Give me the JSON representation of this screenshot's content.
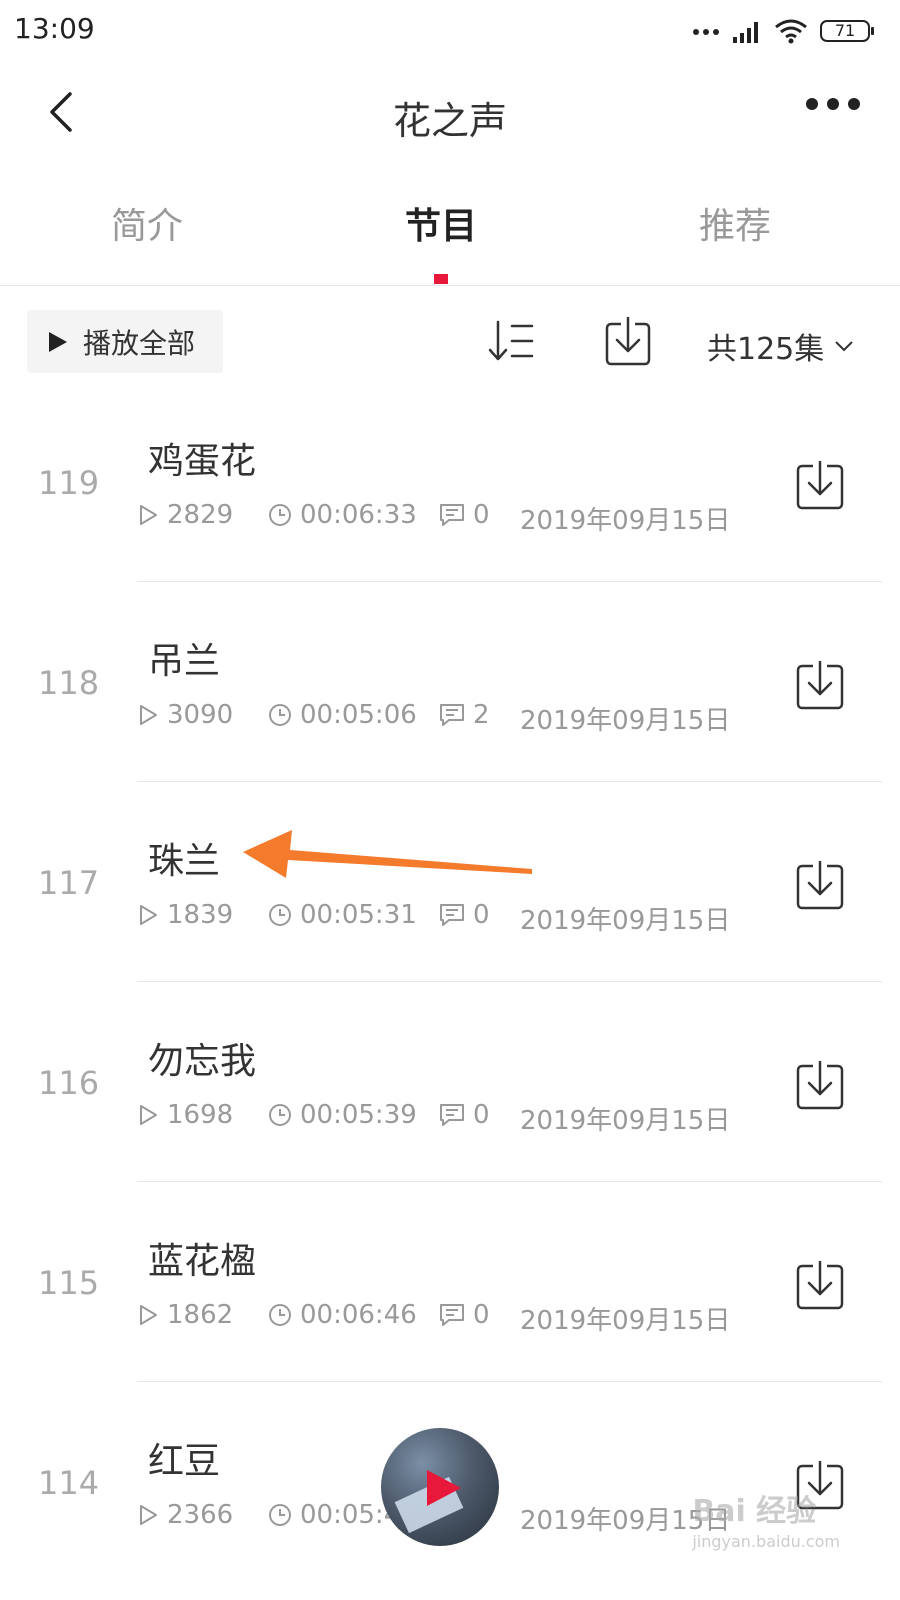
{
  "status_bar": {
    "time": "13:09",
    "battery": "71"
  },
  "header": {
    "title": "花之声"
  },
  "tabs": [
    {
      "label": "简介"
    },
    {
      "label": "节目"
    },
    {
      "label": "推荐"
    }
  ],
  "active_tab": "节目",
  "toolbar": {
    "play_all_label": "播放全部",
    "episode_count": "共125集"
  },
  "episodes": [
    {
      "number": "119",
      "title": "鸡蛋花",
      "plays": "2829",
      "duration": "00:06:33",
      "comments": "0",
      "date": "2019年09月15日"
    },
    {
      "number": "118",
      "title": "吊兰",
      "plays": "3090",
      "duration": "00:05:06",
      "comments": "2",
      "date": "2019年09月15日"
    },
    {
      "number": "117",
      "title": "珠兰",
      "plays": "1839",
      "duration": "00:05:31",
      "comments": "0",
      "date": "2019年09月15日"
    },
    {
      "number": "116",
      "title": "勿忘我",
      "plays": "1698",
      "duration": "00:05:39",
      "comments": "0",
      "date": "2019年09月15日"
    },
    {
      "number": "115",
      "title": "蓝花楹",
      "plays": "1862",
      "duration": "00:06:46",
      "comments": "0",
      "date": "2019年09月15日"
    },
    {
      "number": "114",
      "title": "红豆",
      "plays": "2366",
      "duration": "00:05:4",
      "comments": "",
      "date": "2019年09月15日"
    }
  ],
  "watermark": {
    "brand": "Bai 经验",
    "url": "jingyan.baidu.com"
  },
  "colors": {
    "accent": "#e8183b",
    "annotation_arrow": "#f47a2c",
    "text_primary": "#333333",
    "text_secondary": "#999999"
  },
  "icons": [
    "back-icon",
    "more-icon",
    "sort-icon",
    "download-icon",
    "play-icon",
    "clock-icon",
    "comment-icon",
    "chevron-down-icon",
    "signal-icon",
    "wifi-icon",
    "battery-icon"
  ]
}
